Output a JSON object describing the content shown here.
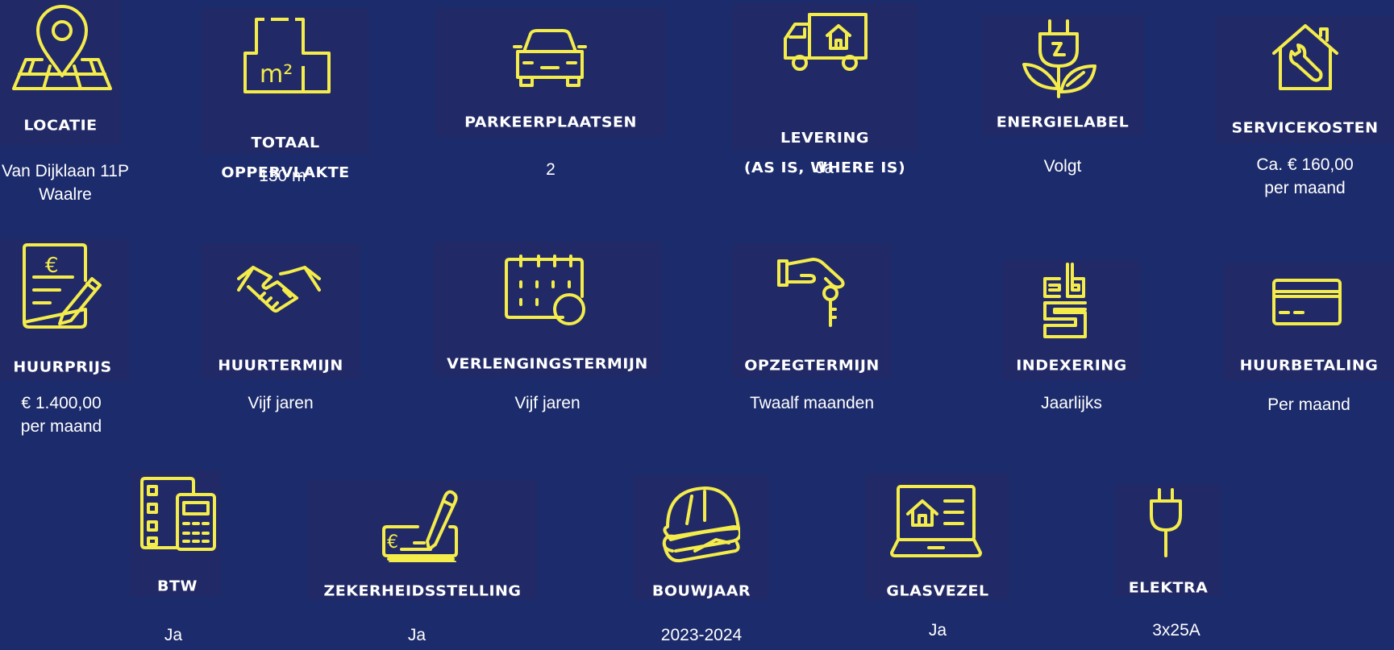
{
  "colors": {
    "background": "#1c2b6b",
    "tile": "#212a66",
    "icon": "#f4ec4b",
    "text": "#ffffff"
  },
  "items": [
    {
      "icon": "map-pin-icon",
      "label": "LOCATIE",
      "value_line1": "Van Dijklaan 11P",
      "value_line2": "Waalre"
    },
    {
      "icon": "floor-area-icon",
      "icon_text": "m²",
      "label_line1": "TOTAAL",
      "label_line2": "OPPERVLAKTE",
      "value": "130 m",
      "value_sup": "2"
    },
    {
      "icon": "car-icon",
      "label": "PARKEERPLAATSEN",
      "value": "2"
    },
    {
      "icon": "delivery-truck-icon",
      "label_line1": "LEVERING",
      "label_line2": "(AS IS, WHERE IS)",
      "value": "Ja"
    },
    {
      "icon": "plug-leaf-icon",
      "label": "ENERGIELABEL",
      "value": "Volgt"
    },
    {
      "icon": "house-wrench-icon",
      "label": "SERVICEKOSTEN",
      "value_line1": "Ca. € 160,00",
      "value_line2": "per maand"
    },
    {
      "icon": "invoice-pen-icon",
      "icon_text": "€",
      "label": "HUURPRIJS",
      "value_line1": "€ 1.400,00",
      "value_line2": "per maand"
    },
    {
      "icon": "handshake-icon",
      "label": "HUURTERMIJN",
      "value": "Vijf jaren"
    },
    {
      "icon": "calendar-icon",
      "label": "VERLENGINGSTERMIJN",
      "value": "Vijf jaren"
    },
    {
      "icon": "hand-key-icon",
      "label": "OPZEGTERMIJN",
      "value": "Twaalf maanden"
    },
    {
      "icon": "cbs-logo-icon",
      "label": "INDEXERING",
      "value": "Jaarlijks"
    },
    {
      "icon": "credit-card-icon",
      "label": "HUURBETALING",
      "value": "Per maand"
    },
    {
      "icon": "calculator-list-icon",
      "label": "BTW",
      "value": "Ja"
    },
    {
      "icon": "cheque-pen-icon",
      "icon_text": "€",
      "label": "ZEKERHEIDSSTELLING",
      "value": "Ja"
    },
    {
      "icon": "hardhat-blueprint-icon",
      "label": "BOUWJAAR",
      "value": "2023-2024"
    },
    {
      "icon": "laptop-house-icon",
      "label": "GLASVEZEL",
      "value": "Ja"
    },
    {
      "icon": "plug-icon",
      "label": "ELEKTRA",
      "value": "3x25A"
    }
  ]
}
